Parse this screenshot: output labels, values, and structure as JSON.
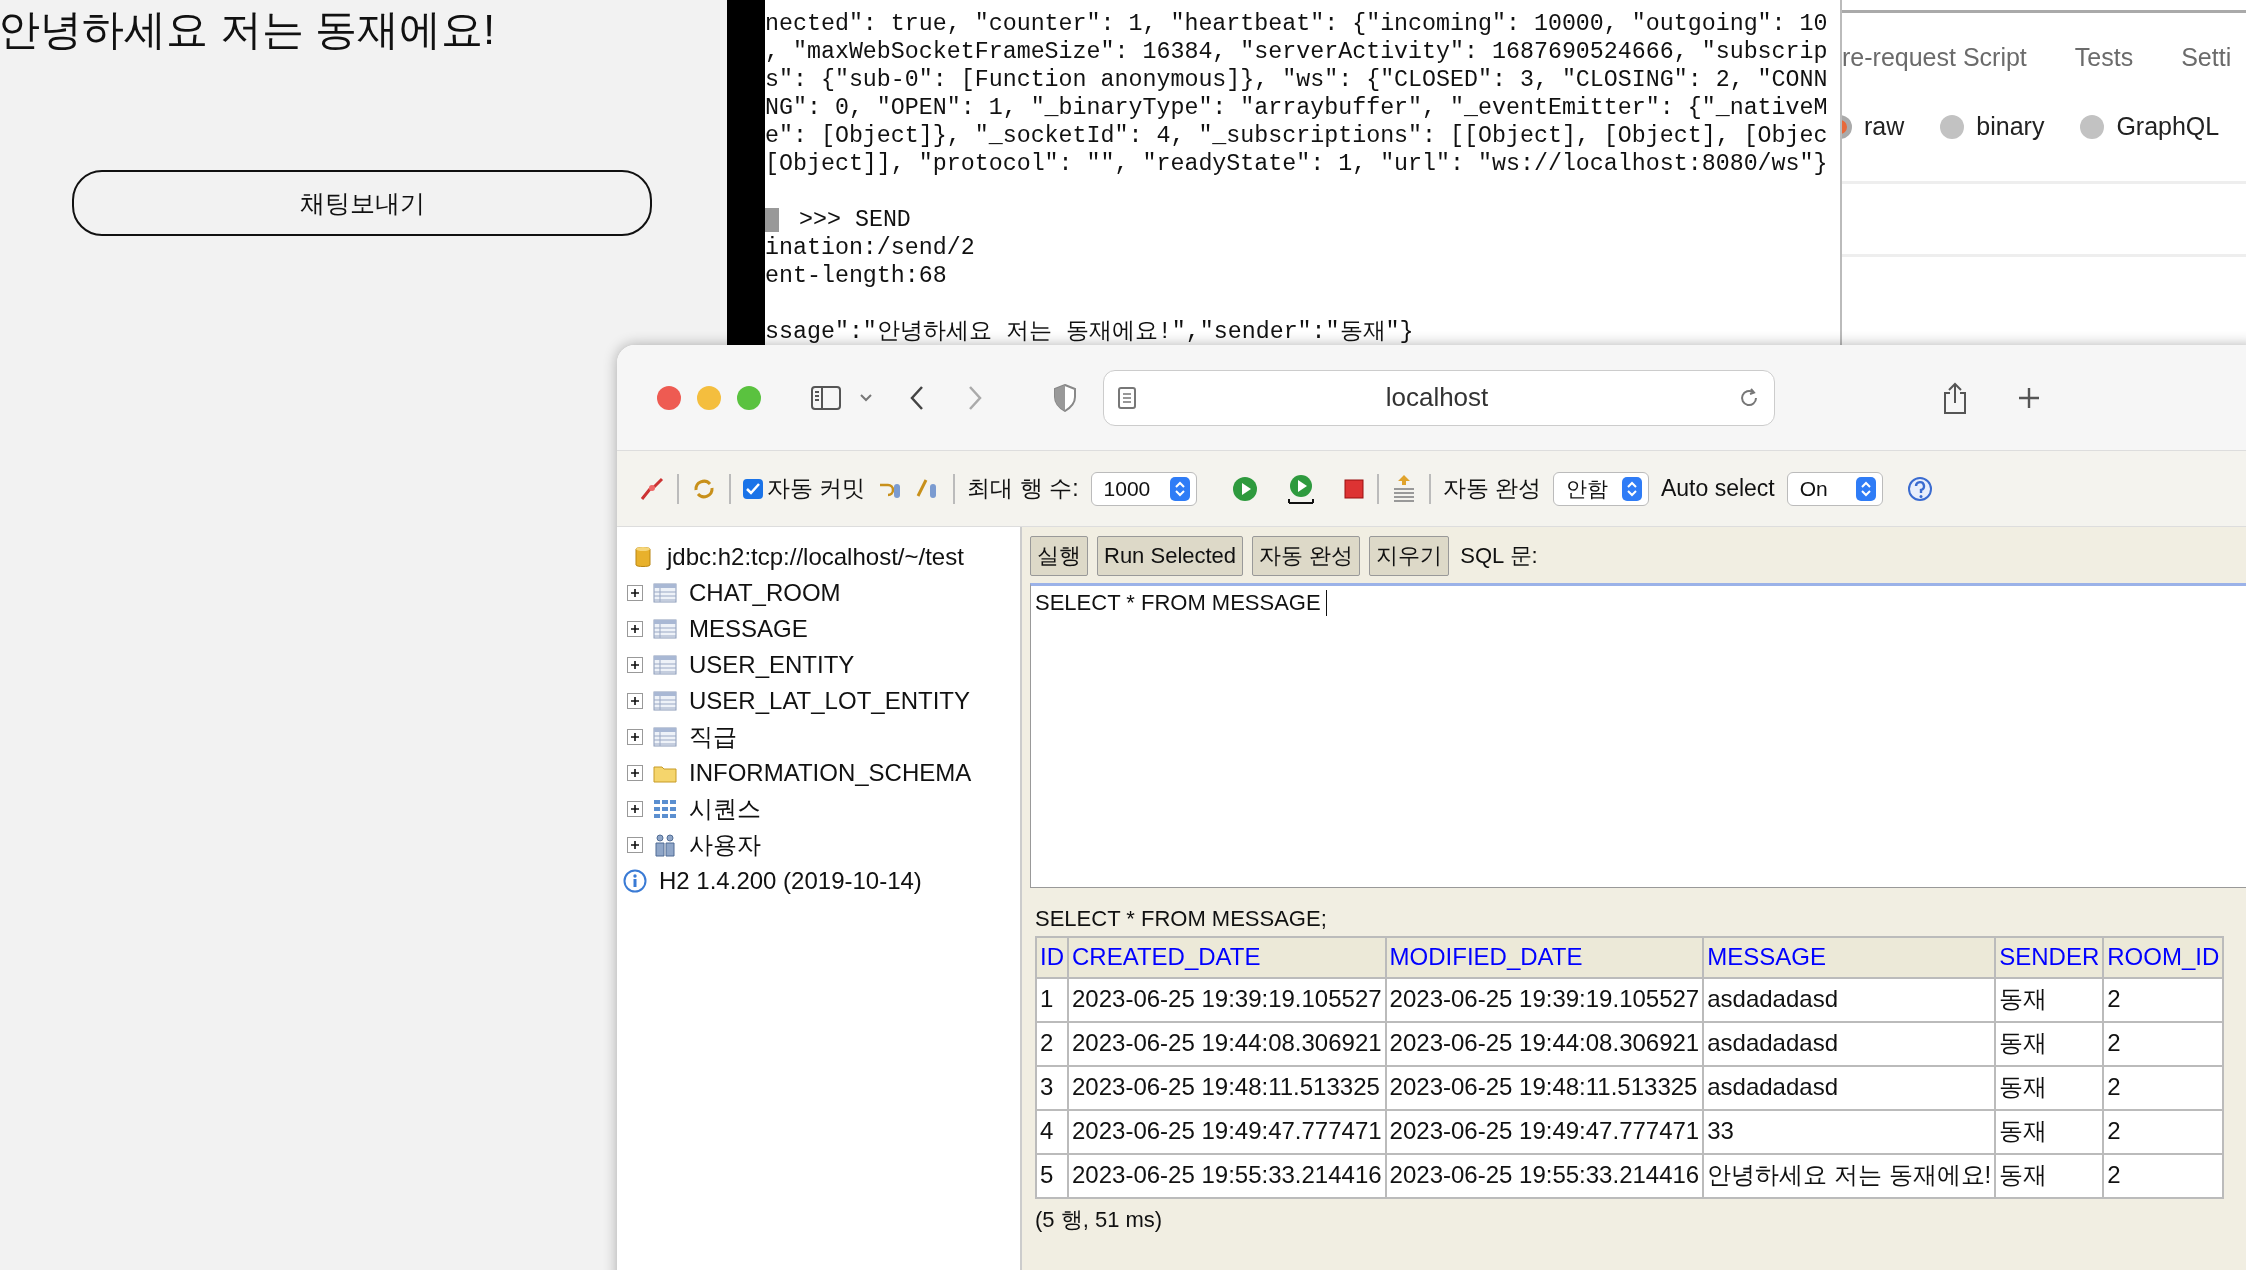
{
  "chat_page": {
    "heading": "안녕하세요 저는 동재에요!",
    "send_button": "채팅보내기"
  },
  "terminal": {
    "blocks": [
      {
        "lines": [
          {
            "text": "nected\": true, \"counter\": 1, \"heartbeat\": {\"incoming\": 10000, \"outgoing\": 10",
            "cursor": false
          },
          {
            "text": ", \"maxWebSocketFrameSize\": 16384, \"serverActivity\": 1687690524666, \"subscrip",
            "cursor": false
          },
          {
            "text": "s\": {\"sub-0\": [Function anonymous]}, \"ws\": {\"CLOSED\": 3, \"CLOSING\": 2, \"CONN",
            "cursor": false
          },
          {
            "text": "NG\": 0, \"OPEN\": 1, \"_binaryType\": \"arraybuffer\", \"_eventEmitter\": {\"_nativeM",
            "cursor": false
          },
          {
            "text": "e\": [Object]}, \"_socketId\": 4, \"_subscriptions\": [[Object], [Object], [Objec",
            "cursor": false
          },
          {
            "text": "[Object]], \"protocol\": \"\", \"readyState\": 1, \"url\": \"ws://localhost:8080/ws\"}",
            "cursor": false
          }
        ]
      },
      {
        "lines": [
          {
            "text": ">>> SEND",
            "cursor": true
          },
          {
            "text": "ination:/send/2",
            "cursor": false
          },
          {
            "text": "ent-length:68",
            "cursor": false
          }
        ]
      },
      {
        "lines": [
          {
            "text": "ssage\":\"안녕하세요 저는 동재에요!\",\"sender\":\"동재\"}",
            "cursor": false
          }
        ]
      }
    ]
  },
  "request_panel": {
    "tabs": [
      {
        "label": "re-request Script"
      },
      {
        "label": "Tests"
      },
      {
        "label": "Setti"
      }
    ],
    "body_types": [
      {
        "label": "raw",
        "selected": true
      },
      {
        "label": "binary",
        "selected": false
      },
      {
        "label": "GraphQL",
        "selected": false
      }
    ]
  },
  "browser": {
    "address": "localhost"
  },
  "h2": {
    "toolbar": {
      "autocommit": {
        "label": "자동 커밋",
        "checked": true
      },
      "max_rows": {
        "label": "최대 행 수:",
        "value": "1000"
      },
      "autocomplete": {
        "label": "자동 완성",
        "value": "안함"
      },
      "auto_select": {
        "label": "Auto select",
        "value": "On"
      }
    },
    "tree": [
      {
        "kind": "database",
        "label": "jdbc:h2:tcp://localhost/~/test"
      },
      {
        "kind": "table",
        "label": "CHAT_ROOM",
        "expanded": false
      },
      {
        "kind": "table",
        "label": "MESSAGE",
        "expanded": false
      },
      {
        "kind": "table",
        "label": "USER_ENTITY",
        "expanded": false
      },
      {
        "kind": "table",
        "label": "USER_LAT_LOT_ENTITY",
        "expanded": false
      },
      {
        "kind": "table",
        "label": "직급",
        "expanded": false
      },
      {
        "kind": "folder",
        "label": "INFORMATION_SCHEMA",
        "expanded": false
      },
      {
        "kind": "sequences",
        "label": "시퀀스",
        "expanded": false
      },
      {
        "kind": "users",
        "label": "사용자",
        "expanded": false
      },
      {
        "kind": "info",
        "label": "H2 1.4.200 (2019-10-14)"
      }
    ],
    "buttons": [
      "실행",
      "Run Selected",
      "자동 완성",
      "지우기"
    ],
    "sql_label": "SQL 문:",
    "sql": "SELECT * FROM MESSAGE",
    "result": {
      "query": "SELECT * FROM MESSAGE;",
      "columns": [
        "ID",
        "CREATED_DATE",
        "MODIFIED_DATE",
        "MESSAGE",
        "SENDER",
        "ROOM_ID"
      ],
      "rows": [
        [
          "1",
          "2023-06-25 19:39:19.105527",
          "2023-06-25 19:39:19.105527",
          "asdadadasd",
          "동재",
          "2"
        ],
        [
          "2",
          "2023-06-25 19:44:08.306921",
          "2023-06-25 19:44:08.306921",
          "asdadadasd",
          "동재",
          "2"
        ],
        [
          "3",
          "2023-06-25 19:48:11.513325",
          "2023-06-25 19:48:11.513325",
          "asdadadasd",
          "동재",
          "2"
        ],
        [
          "4",
          "2023-06-25 19:49:47.777471",
          "2023-06-25 19:49:47.777471",
          "33",
          "동재",
          "2"
        ],
        [
          "5",
          "2023-06-25 19:55:33.214416",
          "2023-06-25 19:55:33.214416",
          "안녕하세요 저는 동재에요!",
          "동재",
          "2"
        ]
      ],
      "footer": "(5 행, 51 ms)"
    }
  }
}
